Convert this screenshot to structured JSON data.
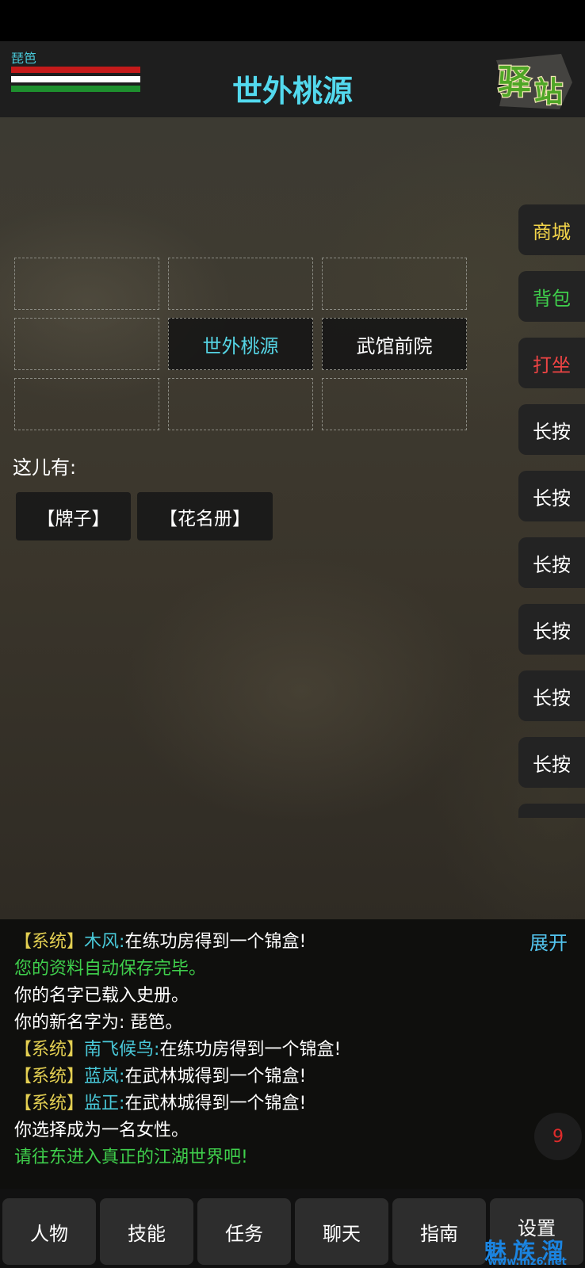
{
  "header": {
    "player_name": "琵笆",
    "location_title": "世外桃源",
    "station_logo_text": "驿站",
    "colors": {
      "hp": "#c41a1a",
      "mp": "#ffffff",
      "sp": "#1e8f2e",
      "title": "#53d9ee"
    }
  },
  "map": {
    "current": "世外桃源",
    "east": "武馆前院"
  },
  "here": {
    "label": "这儿有:",
    "items": [
      "【牌子】",
      "【花名册】"
    ]
  },
  "side_menu": {
    "shop": "商城",
    "bag": "背包",
    "meditate": "打坐",
    "slots": [
      "长按",
      "长按",
      "长按",
      "长按",
      "长按",
      "长按"
    ]
  },
  "log": {
    "expand_label": "展开",
    "lines": [
      {
        "tag": "【系统】",
        "name": "木风:",
        "text": "在练功房得到一个锦盒!"
      },
      {
        "text": "您的资料自动保存完毕。"
      },
      {
        "text": "你的名字已载入史册。"
      },
      {
        "text": "你的新名字为: 琵笆。"
      },
      {
        "tag": "【系统】",
        "name": "南飞候鸟:",
        "text": "在练功房得到一个锦盒!"
      },
      {
        "tag": "【系统】",
        "name": "蓝岚:",
        "text": "在武林城得到一个锦盒!"
      },
      {
        "tag": "【系统】",
        "name": "监正:",
        "text": "在武林城得到一个锦盒!"
      },
      {
        "text": "你选择成为一名女性。"
      },
      {
        "text": "请往东进入真正的江湖世界吧!"
      }
    ]
  },
  "notification": {
    "count": "9"
  },
  "nav": {
    "character": "人物",
    "skills": "技能",
    "quests": "任务",
    "chat": "聊天",
    "guide": "指南",
    "settings": "设置"
  },
  "watermark": {
    "title": "魅族溜",
    "url": "www.mz6.net"
  }
}
